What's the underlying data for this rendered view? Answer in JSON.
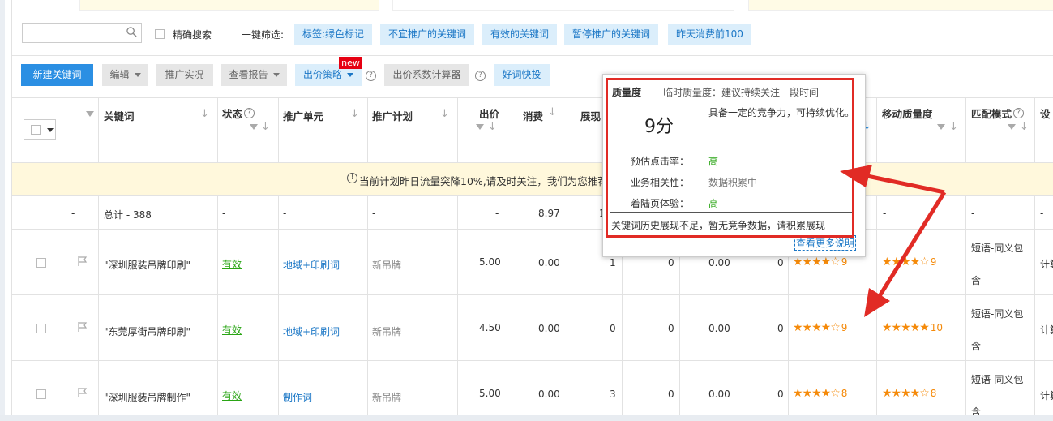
{
  "search": {
    "placeholder": "",
    "exact_label": "精确搜索"
  },
  "filters": {
    "label": "一键筛选:",
    "items": [
      "标签:绿色标记",
      "不宜推广的关键词",
      "有效的关键词",
      "暂停推广的关键词",
      "昨天消费前100"
    ]
  },
  "toolbar": {
    "new_keyword": "新建关键词",
    "edit": "编辑",
    "promo_live": "推广实况",
    "view_report": "查看报告",
    "bid_strategy": "出价策略",
    "new_badge": "new",
    "bid_calc": "出价系数计算器",
    "good_words": "好词快投"
  },
  "columns": {
    "keyword": "关键词",
    "status": "状态",
    "unit": "推广单元",
    "plan": "推广计划",
    "bid": "出价",
    "cost": "消费",
    "impressions": "展现",
    "mobile_quality": "移动质量度",
    "match": "匹配模式",
    "settings": "设"
  },
  "notice": "当前计划昨日流量突降10%,请及时关注，我们为您推荐了",
  "totals": {
    "dash1": "-",
    "label": "总计 - 388",
    "dash2": "-",
    "dash3": "-",
    "dash4": "-",
    "dash5": "-",
    "cost": "8.97",
    "impressions": "1",
    "dash6": "-",
    "dash7": "-",
    "dash8": "-"
  },
  "rows": [
    {
      "keyword": "\"深圳服装吊牌印刷\"",
      "status": "有效",
      "unit": "地域+印刷词",
      "plan": "新吊牌",
      "bid": "5.00",
      "cost": "0.00",
      "impressions": "1",
      "clicks": "0",
      "avg": "0.00",
      "c9": "0",
      "pc_stars": "★★★★☆",
      "pc_score": "9",
      "m_stars": "★★★★☆",
      "m_score": "9",
      "match1": "短语-同义包",
      "match2": "含",
      "set": "计算"
    },
    {
      "keyword": "\"东莞厚街吊牌印刷\"",
      "status": "有效",
      "unit": "地域+印刷词",
      "plan": "新吊牌",
      "bid": "4.50",
      "cost": "0.00",
      "impressions": "0",
      "clicks": "0",
      "avg": "0.00",
      "c9": "0",
      "pc_stars": "★★★★☆",
      "pc_score": "9",
      "m_stars": "★★★★★",
      "m_score": "10",
      "match1": "短语-同义包",
      "match2": "含",
      "set": "计算"
    },
    {
      "keyword": "\"深圳服装吊牌制作\"",
      "status": "有效",
      "unit": "制作词",
      "plan": "新吊牌",
      "bid": "5.00",
      "cost": "0.00",
      "impressions": "3",
      "clicks": "0",
      "avg": "0.00",
      "c9": "0",
      "pc_stars": "★★★★☆",
      "pc_score": "8",
      "m_stars": "★★★★☆",
      "m_score": "8",
      "match1": "短语-同义包",
      "match2": "含",
      "set": "计算"
    }
  ],
  "popup": {
    "title": "质量度",
    "subtitle": "临时质量度：建议持续关注一段时间",
    "score": "9分",
    "score_desc": "具备一定的竞争力，可持续优化。",
    "ctr_label": "预估点击率：",
    "ctr_value": "高",
    "rel_label": "业务相关性：",
    "rel_value": "数据积累中",
    "lp_label": "着陆页体验：",
    "lp_value": "高",
    "footer": "关键词历史展现不足，暂无竞争数据，请积累展现",
    "more": "查看更多说明"
  },
  "colors": {
    "primary": "#2b8fe3",
    "annotation_red": "#e12b25",
    "star_orange": "#f58a0a",
    "valid_green": "#2aa515"
  }
}
